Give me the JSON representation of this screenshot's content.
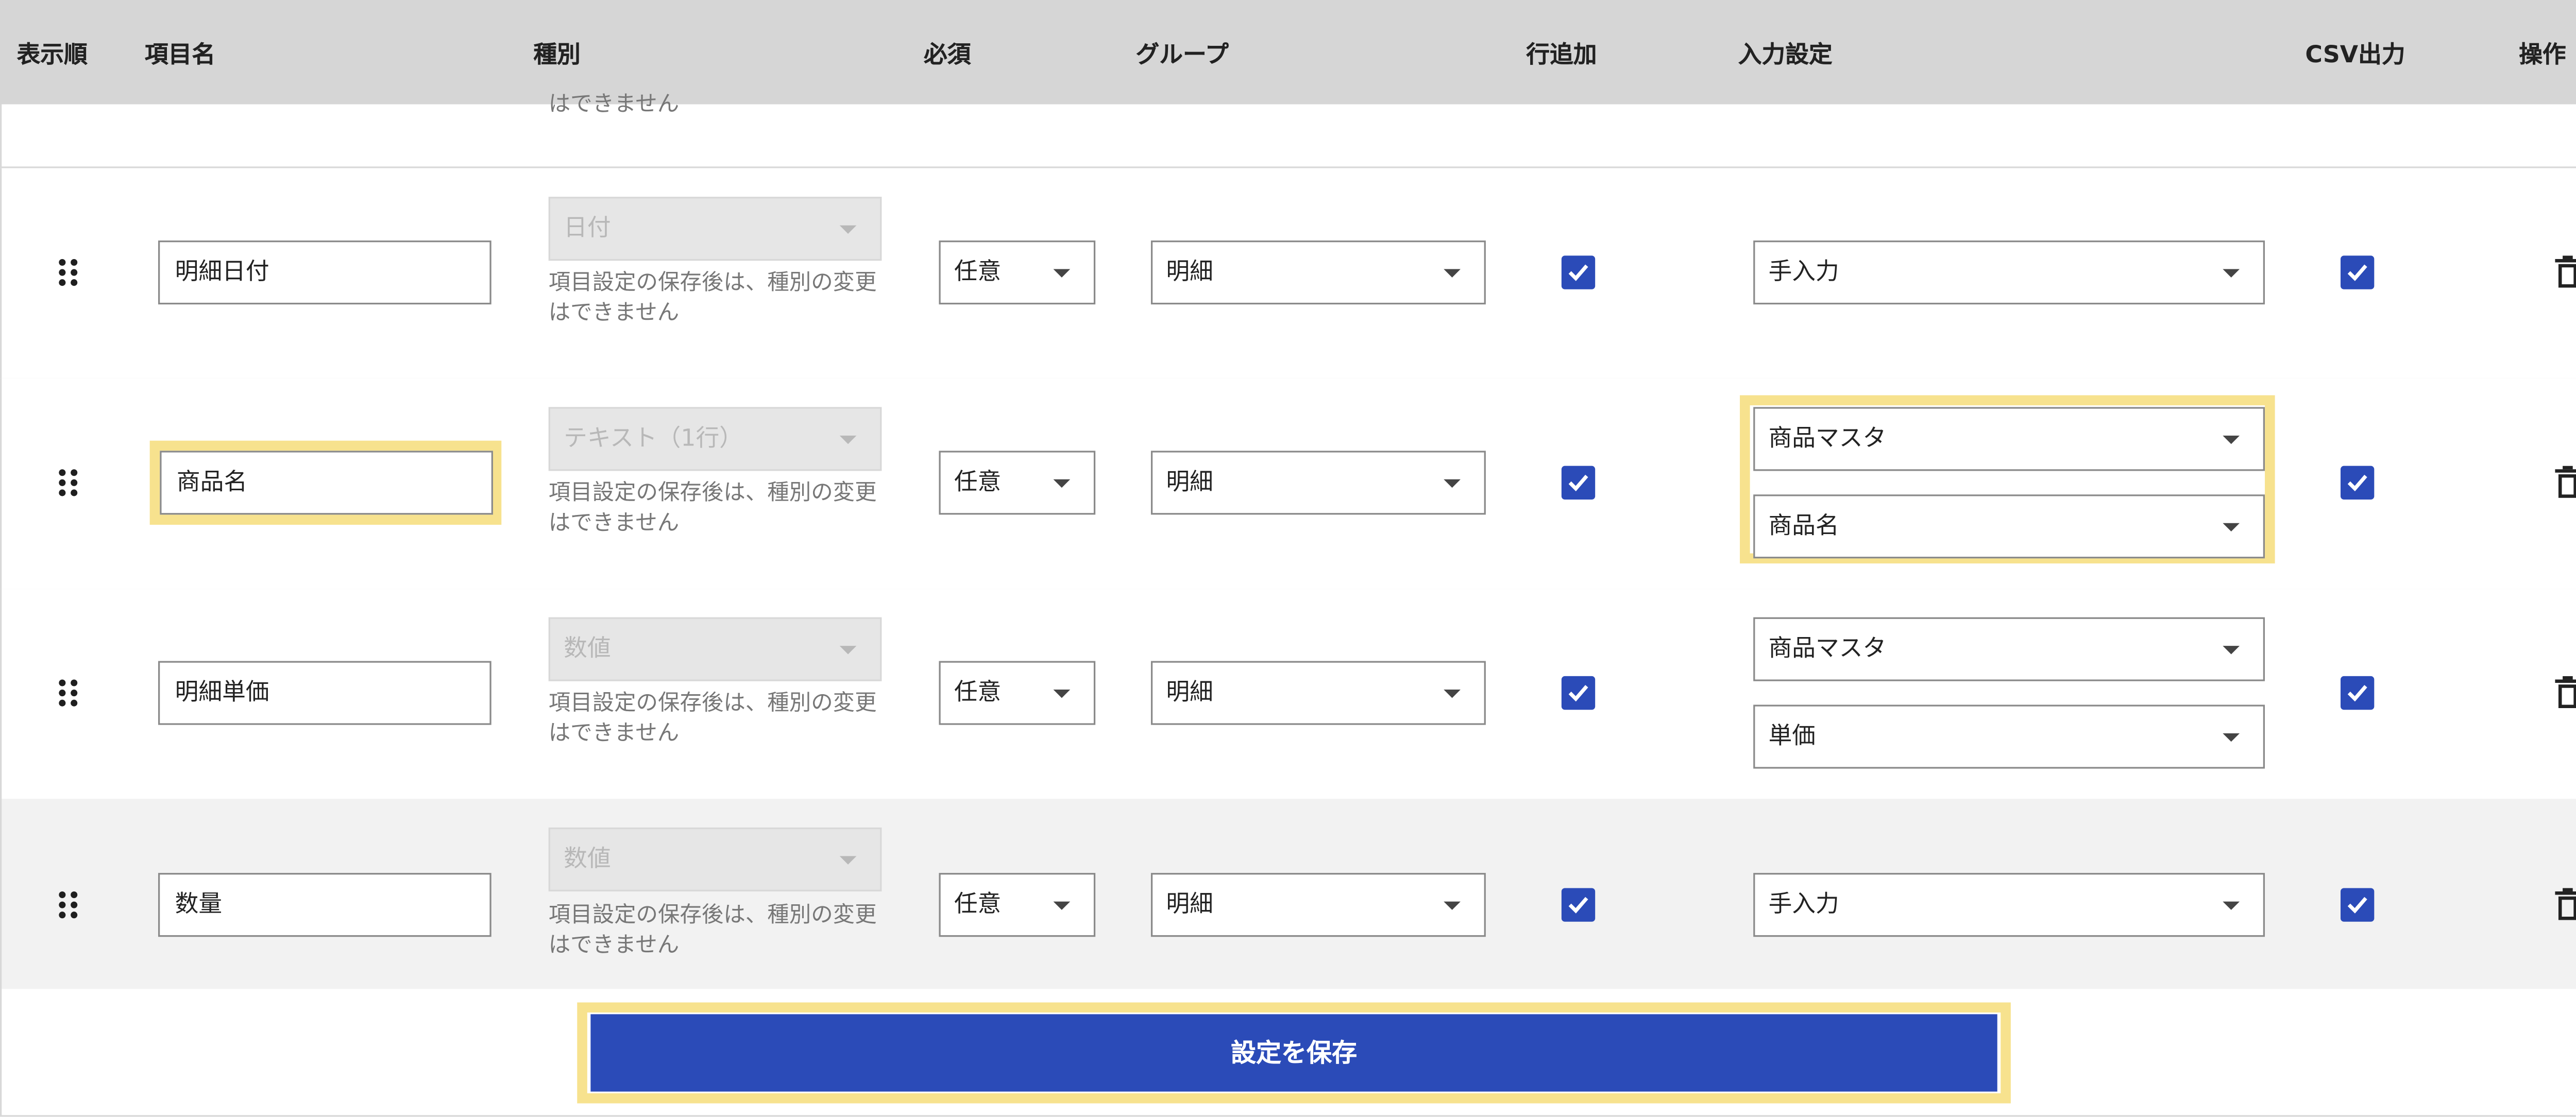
{
  "columns": {
    "order": "表示順",
    "name": "項目名",
    "type": "種別",
    "required": "必須",
    "group": "グループ",
    "add_row": "行追加",
    "input_setting": "入力設定",
    "csv": "CSV出力",
    "ops": "操作"
  },
  "prev_row_note": "はできません",
  "rows": [
    {
      "name": "明細日付",
      "type": "日付",
      "type_note": "項目設定の保存後は、種別の変更はできません",
      "required": "任意",
      "group": "明細",
      "add_row": true,
      "input_setting": [
        "手入力"
      ],
      "csv": true
    },
    {
      "name": "商品名",
      "type": "テキスト（1行）",
      "type_note": "項目設定の保存後は、種別の変更はできません",
      "required": "任意",
      "group": "明細",
      "add_row": true,
      "input_setting": [
        "商品マスタ",
        "商品名"
      ],
      "csv": true
    },
    {
      "name": "明細単価",
      "type": "数値",
      "type_note": "項目設定の保存後は、種別の変更はできません",
      "required": "任意",
      "group": "明細",
      "add_row": true,
      "input_setting": [
        "商品マスタ",
        "単価"
      ],
      "csv": true
    },
    {
      "name": "数量",
      "type": "数値",
      "type_note": "項目設定の保存後は、種別の変更はできません",
      "required": "任意",
      "group": "明細",
      "add_row": true,
      "input_setting": [
        "手入力"
      ],
      "csv": true
    }
  ],
  "save_button": "設定を保存",
  "colors": {
    "accent": "#2b4bb8",
    "highlight": "#f7e28e",
    "header_bg": "#d6d6d6"
  },
  "icons": {
    "drag_handle": "drag-handle-icon",
    "checkbox": "checkmark-icon",
    "delete": "trash-icon",
    "dropdown": "chevron-down-icon"
  }
}
